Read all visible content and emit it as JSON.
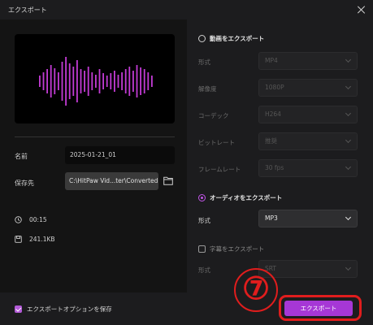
{
  "window": {
    "title": "エクスポート"
  },
  "preview": {
    "bar_color": "#c23bd4"
  },
  "file": {
    "name_label": "名前",
    "name_value": "2025-01-21_01",
    "save_label": "保存先",
    "save_path": "C:\\HitPaw Vid...ter\\Converted",
    "duration": "00:15",
    "size": "241.1KB"
  },
  "video_export": {
    "label": "動画をエクスポート",
    "selected": false,
    "format_label": "形式",
    "format_value": "MP4",
    "resolution_label": "解像度",
    "resolution_value": "1080P",
    "codec_label": "コーデック",
    "codec_value": "H264",
    "bitrate_label": "ビットレート",
    "bitrate_value": "推奨",
    "framerate_label": "フレームレート",
    "framerate_value": "30  fps"
  },
  "audio_export": {
    "label": "オーディオをエクスポート",
    "selected": true,
    "format_label": "形式",
    "format_value": "MP3"
  },
  "subtitle_export": {
    "label": "字幕をエクスポート",
    "checked": false,
    "format_label": "形式",
    "format_value": "SRT"
  },
  "footer": {
    "save_options_label": "エクスポートオプションを保存",
    "save_options_checked": true,
    "export_label": "エクスポート",
    "accent": "#a637d6"
  },
  "annotation": {
    "step_number": "⑦",
    "highlight_color": "#e01d1d"
  }
}
